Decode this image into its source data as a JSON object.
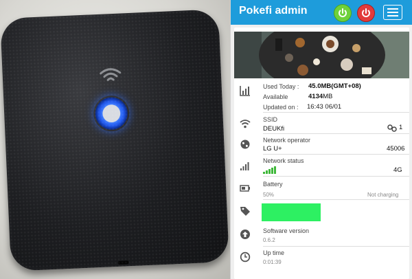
{
  "header": {
    "title": "Pokefi admin"
  },
  "usage": {
    "used_label": "Used Today :",
    "used_value": "45.0MB(GMT+08)",
    "available_label": "Available",
    "available_value": "4134",
    "available_unit": "MB",
    "updated_label": "Updated on :",
    "updated_value": "16:43 06/01"
  },
  "ssid": {
    "label": "SSID",
    "value": "DEUKfi",
    "clients": "1"
  },
  "operator": {
    "label": "Network operator",
    "value": "LG U+",
    "code": "45006"
  },
  "network": {
    "label": "Network status",
    "type": "4G"
  },
  "battery": {
    "label": "Battery",
    "level": "50%",
    "state": "Not charging"
  },
  "software": {
    "label": "Software version",
    "value": "0.6.2"
  },
  "uptime": {
    "label": "Up time",
    "value": "0:01:39"
  },
  "colors": {
    "topbar": "#1e9cdb",
    "signal": "#3fb83a",
    "power_green": "#6fd13b",
    "power_red": "#e23b3b",
    "tag_block": "#2df062"
  },
  "icons": [
    "wifi-icon",
    "refresh-power-icon",
    "power-icon",
    "menu-icon",
    "chart-icon",
    "globe-icon",
    "signal-icon",
    "battery-icon",
    "tag-icon",
    "upload-icon",
    "clock-icon",
    "link-icon"
  ]
}
